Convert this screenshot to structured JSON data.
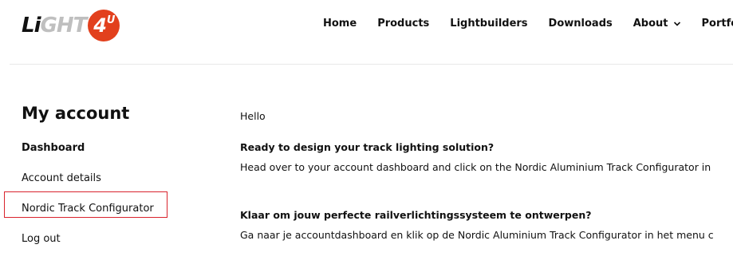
{
  "logo": {
    "part1": "Li",
    "part2": "GHT",
    "badge": "4",
    "badge_sup": "U"
  },
  "nav": {
    "items": [
      {
        "label": "Home"
      },
      {
        "label": "Products"
      },
      {
        "label": "Lightbuilders"
      },
      {
        "label": "Downloads"
      },
      {
        "label": "About",
        "icon": "chevron-down-icon"
      },
      {
        "label": "Portfolio"
      }
    ]
  },
  "sidebar": {
    "title": "My account",
    "items": [
      {
        "label": "Dashboard",
        "active": true
      },
      {
        "label": "Account details"
      },
      {
        "label": "Nordic Track Configurator",
        "highlighted": true
      },
      {
        "label": "Log out"
      }
    ]
  },
  "main": {
    "greeting": "Hello",
    "heading_en": "Ready to design your track lighting solution?",
    "text_en": "Head over to your account dashboard and click on the Nordic Aluminium Track Configurator in",
    "heading_nl": "Klaar om jouw perfecte railverlichtingssysteem te ontwerpen?",
    "text_nl": "Ga naar je accountdashboard en klik op de Nordic Aluminium Track Configurator in het menu c"
  },
  "colors": {
    "brand": "#e2401d",
    "highlight": "#d9232d",
    "text": "#111111"
  }
}
